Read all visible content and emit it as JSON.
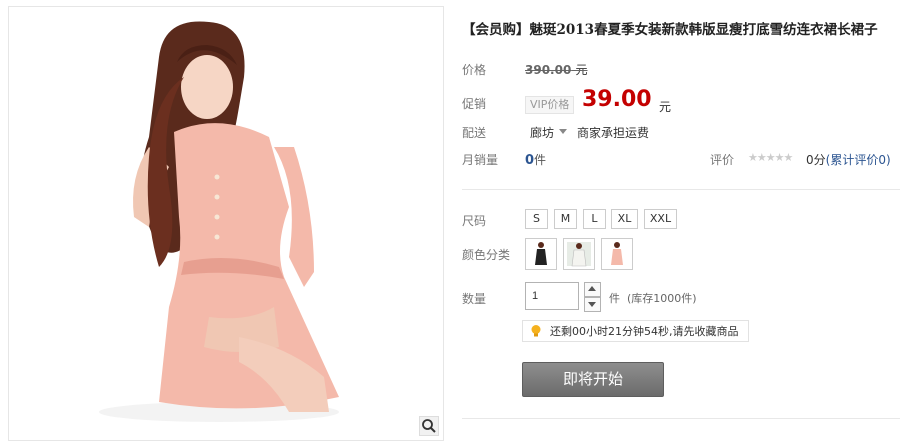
{
  "product": {
    "title": "【会员购】魅珽2013春夏季女装新款韩版显瘦打底雪纺连衣裙长裙子"
  },
  "price": {
    "label": "价格",
    "original": "390.00",
    "unit": "元"
  },
  "promo": {
    "label": "促销",
    "tag": "VIP价格",
    "price": "39.00",
    "unit": "元"
  },
  "shipping": {
    "label": "配送",
    "location": "廊坊",
    "note": "商家承担运费"
  },
  "sales": {
    "label": "月销量",
    "count": "0",
    "unit": "件",
    "rating_label": "评价",
    "stars": "★★★★★",
    "score": "0分",
    "review_link": "(累计评价0)"
  },
  "size": {
    "label": "尺码",
    "options": [
      "S",
      "M",
      "L",
      "XL",
      "XXL"
    ]
  },
  "color": {
    "label": "颜色分类",
    "options": [
      "black-dress-swatch",
      "white-dress-swatch",
      "pink-dress-swatch"
    ]
  },
  "quantity": {
    "label": "数量",
    "value": "1",
    "unit": "件",
    "stock": "(库存1000件)"
  },
  "tip": {
    "text": "还剩00小时21分钟54秒,请先收藏商品"
  },
  "action": {
    "button": "即将开始"
  },
  "colors": {
    "promo_red": "#c40000",
    "link_blue": "#2c5591",
    "button_gray": "#7c7c7c"
  }
}
